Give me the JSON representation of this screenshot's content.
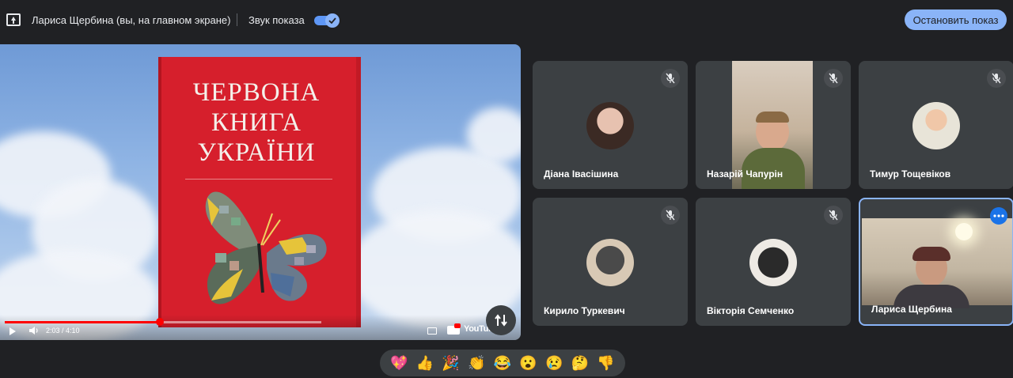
{
  "topbar": {
    "presenter": "Лариса Щербина (вы, на главном экране)",
    "sound_label": "Звук показа",
    "sound_enabled": true,
    "stop_button": "Остановить показ",
    "accent_color": "#8ab4f8"
  },
  "video": {
    "book_title_lines": [
      "ЧЕРВОНА",
      "КНИГА",
      "УКРАЇНИ"
    ],
    "time": "2:03 / 4:10",
    "progress": 0.49,
    "brand": "YouTube"
  },
  "participants": [
    {
      "name": "Діана Івасішина",
      "muted": true
    },
    {
      "name": "Назарій Чапурін",
      "muted": true
    },
    {
      "name": "Тимур Тощевіков",
      "muted": true
    },
    {
      "name": "Кирило Туркевич",
      "muted": true
    },
    {
      "name": "Вікторія Семченко",
      "muted": true
    },
    {
      "name": "Лариса Щербина",
      "muted": false,
      "is_self": true
    }
  ],
  "reactions": [
    {
      "icon": "sparkling-heart-icon",
      "glyph": "💖"
    },
    {
      "icon": "thumbs-up-icon",
      "glyph": "👍"
    },
    {
      "icon": "party-popper-icon",
      "glyph": "🎉"
    },
    {
      "icon": "clapping-hands-icon",
      "glyph": "👏"
    },
    {
      "icon": "tears-of-joy-icon",
      "glyph": "😂"
    },
    {
      "icon": "surprised-face-icon",
      "glyph": "😮"
    },
    {
      "icon": "sad-face-icon",
      "glyph": "😢"
    },
    {
      "icon": "thinking-face-icon",
      "glyph": "🤔"
    },
    {
      "icon": "thumbs-down-icon",
      "glyph": "👎"
    }
  ]
}
